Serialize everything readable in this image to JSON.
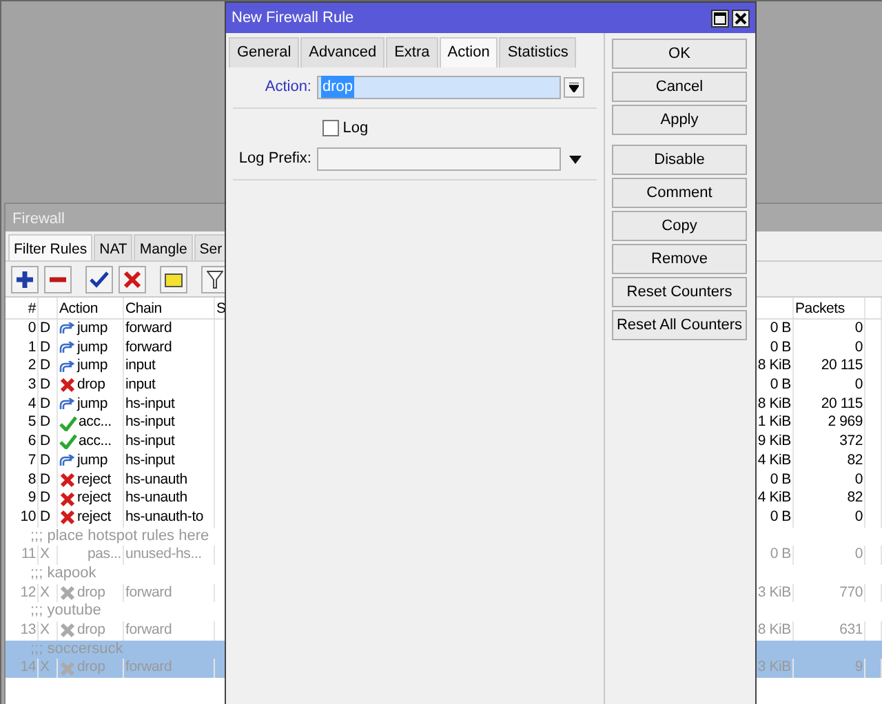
{
  "firewall": {
    "title": "Firewall",
    "tabs": [
      {
        "label": "Filter Rules",
        "selected": true
      },
      {
        "label": "NAT",
        "selected": false
      },
      {
        "label": "Mangle",
        "selected": false
      },
      {
        "label": "Ser",
        "selected": false
      }
    ],
    "toolbar": [
      {
        "kind": "add"
      },
      {
        "kind": "remove"
      },
      {
        "kind": "enable"
      },
      {
        "kind": "disable"
      },
      {
        "kind": "comment"
      },
      {
        "kind": "filter"
      }
    ],
    "columns": {
      "number": "#",
      "action": "Action",
      "chain": "Chain",
      "column_5": "S",
      "packets": "Packets"
    },
    "rows": [
      {
        "kind": "jump",
        "number": "0",
        "flag": "D",
        "action": "jump",
        "chain": "forward",
        "bytes": "0 B",
        "packets": "0",
        "disabled": false,
        "selected": false
      },
      {
        "kind": "jump",
        "number": "1",
        "flag": "D",
        "action": "jump",
        "chain": "forward",
        "bytes": "0 B",
        "packets": "0",
        "disabled": false,
        "selected": false
      },
      {
        "kind": "jump",
        "number": "2",
        "flag": "D",
        "action": "jump",
        "chain": "input",
        "bytes": "8 KiB",
        "packets": "20 115",
        "disabled": false,
        "selected": false
      },
      {
        "kind": "drop",
        "number": "3",
        "flag": "D",
        "action": "drop",
        "chain": "input",
        "bytes": "0 B",
        "packets": "0",
        "disabled": false,
        "selected": false
      },
      {
        "kind": "jump",
        "number": "4",
        "flag": "D",
        "action": "jump",
        "chain": "hs-input",
        "bytes": "8 KiB",
        "packets": "20 115",
        "disabled": false,
        "selected": false
      },
      {
        "kind": "accept",
        "number": "5",
        "flag": "D",
        "action": "acc...",
        "chain": "hs-input",
        "bytes": "1 KiB",
        "packets": "2 969",
        "disabled": false,
        "selected": false
      },
      {
        "kind": "accept",
        "number": "6",
        "flag": "D",
        "action": "acc...",
        "chain": "hs-input",
        "bytes": "9 KiB",
        "packets": "372",
        "disabled": false,
        "selected": false
      },
      {
        "kind": "jump",
        "number": "7",
        "flag": "D",
        "action": "jump",
        "chain": "hs-input",
        "bytes": "4 KiB",
        "packets": "82",
        "disabled": false,
        "selected": false
      },
      {
        "kind": "drop",
        "number": "8",
        "flag": "D",
        "action": "reject",
        "chain": "hs-unauth",
        "bytes": "0 B",
        "packets": "0",
        "disabled": false,
        "selected": false
      },
      {
        "kind": "drop",
        "number": "9",
        "flag": "D",
        "action": "reject",
        "chain": "hs-unauth",
        "bytes": "4 KiB",
        "packets": "82",
        "disabled": false,
        "selected": false
      },
      {
        "kind": "drop",
        "number": "10",
        "flag": "D",
        "action": "reject",
        "chain": "hs-unauth-to",
        "bytes": "0 B",
        "packets": "0",
        "disabled": false,
        "selected": false
      },
      {
        "kind": "comment",
        "text": ";;; place hotspot rules here",
        "selected": false
      },
      {
        "kind": "passthrough",
        "number": "11",
        "flag": "X",
        "action": "pas...",
        "chain": "unused-hs...",
        "bytes": "0 B",
        "packets": "0",
        "disabled": true,
        "selected": false
      },
      {
        "kind": "comment",
        "text": ";;; kapook",
        "selected": false
      },
      {
        "kind": "drop",
        "number": "12",
        "flag": "X",
        "action": "drop",
        "chain": "forward",
        "bytes": "3 KiB",
        "packets": "770",
        "disabled": true,
        "selected": false
      },
      {
        "kind": "comment",
        "text": ";;; youtube",
        "selected": false
      },
      {
        "kind": "drop",
        "number": "13",
        "flag": "X",
        "action": "drop",
        "chain": "forward",
        "bytes": "8 KiB",
        "packets": "631",
        "disabled": true,
        "selected": false
      },
      {
        "kind": "comment",
        "text": ";;; soccersuck",
        "selected": true
      },
      {
        "kind": "drop",
        "number": "14",
        "flag": "X",
        "action": "drop",
        "chain": "forward",
        "bytes": "3 KiB",
        "packets": "9",
        "disabled": true,
        "selected": true
      }
    ]
  },
  "dialog": {
    "title": "New Firewall Rule",
    "tabs": [
      {
        "label": "General",
        "selected": false
      },
      {
        "label": "Advanced",
        "selected": false
      },
      {
        "label": "Extra",
        "selected": false
      },
      {
        "label": "Action",
        "selected": true
      },
      {
        "label": "Statistics",
        "selected": false
      }
    ],
    "action_label": "Action:",
    "action_value": "drop",
    "log": {
      "label": "Log",
      "checked": false
    },
    "log_prefix_label": "Log Prefix:",
    "button_groups": [
      [
        "OK",
        "Cancel",
        "Apply"
      ],
      [
        "Disable",
        "Comment",
        "Copy",
        "Remove",
        "Reset Counters",
        "Reset All Counters"
      ]
    ]
  }
}
